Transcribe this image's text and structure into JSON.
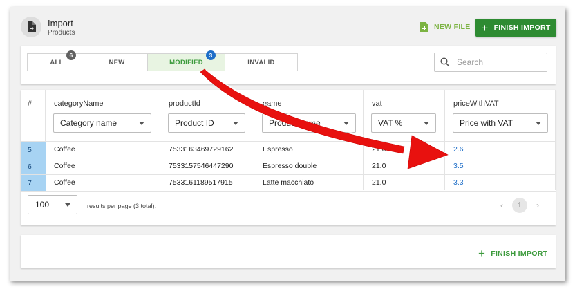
{
  "header": {
    "title": "Import",
    "subtitle": "Products",
    "new_file_label": "NEW FILE",
    "finish_import_label": "FINISH IMPORT"
  },
  "tabs": [
    {
      "label": "ALL",
      "badge": "6",
      "badge_color": "#616161"
    },
    {
      "label": "NEW",
      "badge": ""
    },
    {
      "label": "MODIFIED",
      "badge": "3",
      "badge_color": "#1e6ec8",
      "active": true
    },
    {
      "label": "INVALID",
      "badge": ""
    }
  ],
  "search": {
    "placeholder": "Search"
  },
  "table": {
    "columns": [
      {
        "header": "#",
        "filter": ""
      },
      {
        "header": "categoryName",
        "filter": "Category name"
      },
      {
        "header": "productId",
        "filter": "Product ID"
      },
      {
        "header": "name",
        "filter": "Product name"
      },
      {
        "header": "vat",
        "filter": "VAT %"
      },
      {
        "header": "priceWithVAT",
        "filter": "Price with VAT"
      }
    ],
    "rows": [
      {
        "num": "5",
        "categoryName": "Coffee",
        "productId": "7533163469729162",
        "name": "Espresso",
        "vat": "21.0",
        "priceWithVAT": "2.6"
      },
      {
        "num": "6",
        "categoryName": "Coffee",
        "productId": "7533157546447290",
        "name": "Espresso double",
        "vat": "21.0",
        "priceWithVAT": "3.5"
      },
      {
        "num": "7",
        "categoryName": "Coffee",
        "productId": "7533161189517915",
        "name": "Latte macchiato",
        "vat": "21.0",
        "priceWithVAT": "3.3"
      }
    ]
  },
  "pagination": {
    "per_page": "100",
    "summary": "results per page (3 total).",
    "current_page": "1",
    "prev_icon": "chevron-left-icon",
    "next_icon": "chevron-right-icon"
  },
  "footer": {
    "finish_import_label": "FINISH IMPORT"
  },
  "colors": {
    "accent_green": "#2e8b32",
    "new_file_green": "#7cb342",
    "row_highlight": "#a7d3f3",
    "price_blue": "#1e6ec8",
    "arrow_red": "#e8110f"
  },
  "annotation": {
    "type": "red-arrow",
    "from": "MODIFIED tab",
    "to": "priceWithVAT column"
  }
}
